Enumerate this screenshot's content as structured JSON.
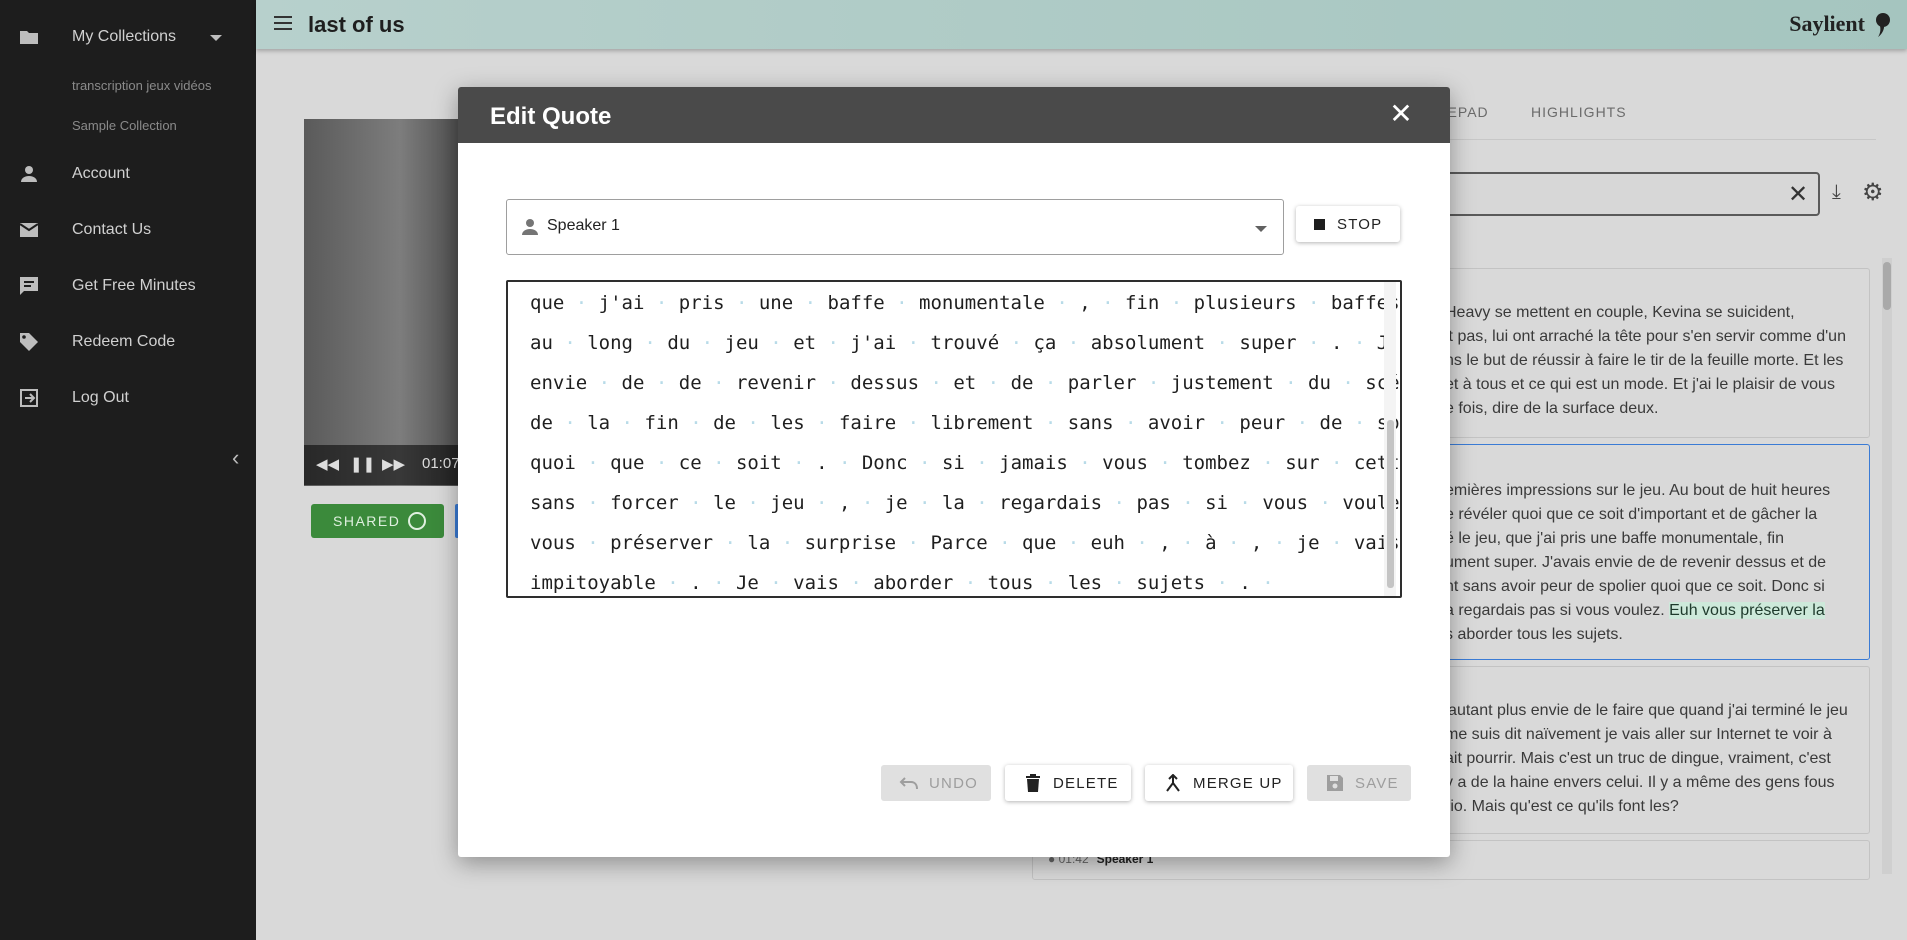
{
  "sidebar": {
    "collections_label": "My Collections",
    "collections": [
      "transcription jeux vidéos",
      "Sample Collection"
    ],
    "items": [
      {
        "label": "Account",
        "icon": "account-icon"
      },
      {
        "label": "Contact Us",
        "icon": "mail-icon"
      },
      {
        "label": "Get Free Minutes",
        "icon": "chat-icon"
      },
      {
        "label": "Redeem Code",
        "icon": "tag-icon"
      },
      {
        "label": "Log Out",
        "icon": "logout-icon"
      }
    ]
  },
  "appbar": {
    "title": "last of us",
    "brand": "Saylient"
  },
  "background": {
    "video_time": "01:07",
    "shared_label": "SHARED",
    "tabs": [
      "TEPAD",
      "HIGHLIGHTS"
    ],
    "cards": [
      {
        "lines": [
          "Heavy se mettent en couple, Kevina se suicident,",
          "it pas, lui ont arraché la tête pour s'en servir comme d'un",
          "ns le but de réussir à faire le tir de la feuille morte. Et les",
          "et à tous et ce qui est un mode. Et j'ai le plaisir de vous",
          "e fois, dire de la surface deux."
        ]
      },
      {
        "lines": [
          "emières impressions sur le jeu. Au bout de huit heures",
          "e révéler quoi que ce soit d'important et de gâcher la",
          "é le jeu, que j'ai pris une baffe monumentale, fin",
          "ument super. J'avais envie de de revenir dessus et de",
          "nt sans avoir peur de spolier quoi que ce soit. Donc si",
          "a regardais pas si vous voulez. "
        ],
        "highlight": "Euh vous préserver la",
        "tail": "s aborder tous les sujets."
      },
      {
        "lines": [
          "'autant plus envie de le faire que quand j'ai terminé le jeu",
          "me suis dit naïvement je vais aller sur Internet te voir à",
          "ait pourrir. Mais c'est un truc de dingue, vraiment, c'est",
          "y a de la haine envers celui. Il y a même des gens fous",
          "rio. Mais qu'est ce qu'ils font les?"
        ]
      }
    ],
    "card4_time": "01:42",
    "card4_speaker": "Speaker 1"
  },
  "modal": {
    "title": "Edit Quote",
    "speaker": "Speaker 1",
    "stop_label": "STOP",
    "lines": [
      "que·j'ai·pris·une·baffe·monumentale·,·fin·plusieurs·baffes·tout·",
      "au·long·du·jeu·et·j'ai·trouvé·ça·absolument·super·.·J'avais·",
      "envie·de·de·revenir·dessus·et·de·parler·justement·du·scénario·",
      "de·la·fin·de·les·faire·librement·sans·avoir·peur·de·spolier·",
      "quoi·que·ce·soit·.·Donc·si·jamais·vous·tombez·sur·cette·vidéo·",
      "sans·forcer·le·jeu·,·je·la·regardais·pas·si·vous·voulez·.·Euh·",
      "vous·préserver·la·surprise·Parce·que·euh·,·à·,·je·vais·être·",
      "impitoyable·.·Je·vais·aborder·tous·les·sujets·.·"
    ],
    "buttons": {
      "undo": "UNDO",
      "delete": "DELETE",
      "merge": "MERGE UP",
      "save": "SAVE"
    }
  }
}
